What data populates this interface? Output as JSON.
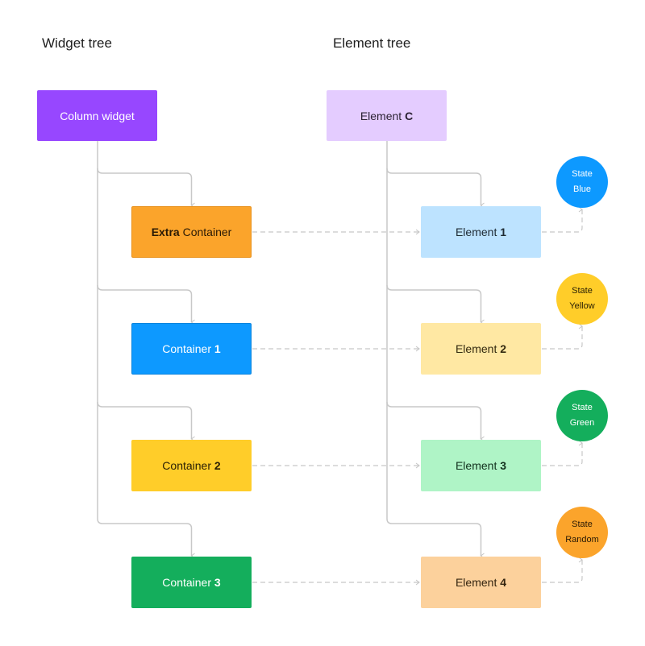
{
  "headings": {
    "widget_tree": "Widget tree",
    "element_tree": "Element tree"
  },
  "widget_tree": {
    "root": {
      "label": "Column widget",
      "color": "#9747FF",
      "text_color": "#ffffff"
    },
    "children": [
      {
        "label_bold": "Extra",
        "label_rest": " Container",
        "bold_first": true,
        "color": "#FBA42B",
        "text_color": "#2a1a05",
        "border": "#E8901A"
      },
      {
        "label_rest": "Container ",
        "label_bold": "1",
        "bold_first": false,
        "color": "#0D99FF",
        "text_color": "#ffffff",
        "border": "#0B84DD"
      },
      {
        "label_rest": "Container ",
        "label_bold": "2",
        "bold_first": false,
        "color": "#FFCD29",
        "text_color": "#2a2005",
        "border": "#FFCD29"
      },
      {
        "label_rest": "Container ",
        "label_bold": "3",
        "bold_first": false,
        "color": "#14AE5C",
        "text_color": "#ffffff",
        "border": "#14AE5C"
      }
    ]
  },
  "element_tree": {
    "root": {
      "label_rest": "Element ",
      "label_bold": "C",
      "color": "#E4CCFF",
      "text_color": "#2b2233"
    },
    "children": [
      {
        "label_rest": "Element ",
        "label_bold": "1",
        "color": "#BDE3FF",
        "text_color": "#1e2a33"
      },
      {
        "label_rest": "Element ",
        "label_bold": "2",
        "color": "#FFE8A3",
        "text_color": "#33290f"
      },
      {
        "label_rest": "Element ",
        "label_bold": "3",
        "color": "#AFF4C6",
        "text_color": "#12301d"
      },
      {
        "label_rest": "Element ",
        "label_bold": "4",
        "color": "#FCD19C",
        "text_color": "#33240f"
      }
    ]
  },
  "states": [
    {
      "line1": "State",
      "line2": "Blue",
      "color": "#0D99FF",
      "text_color": "#ffffff"
    },
    {
      "line1": "State",
      "line2": "Yellow",
      "color": "#FFCD29",
      "text_color": "#2a2005"
    },
    {
      "line1": "State",
      "line2": "Green",
      "color": "#14AE5C",
      "text_color": "#ffffff"
    },
    {
      "line1": "State",
      "line2": "Random",
      "color": "#FBA42B",
      "text_color": "#2a1a05"
    }
  ],
  "connector_color": "#C4C4C4"
}
